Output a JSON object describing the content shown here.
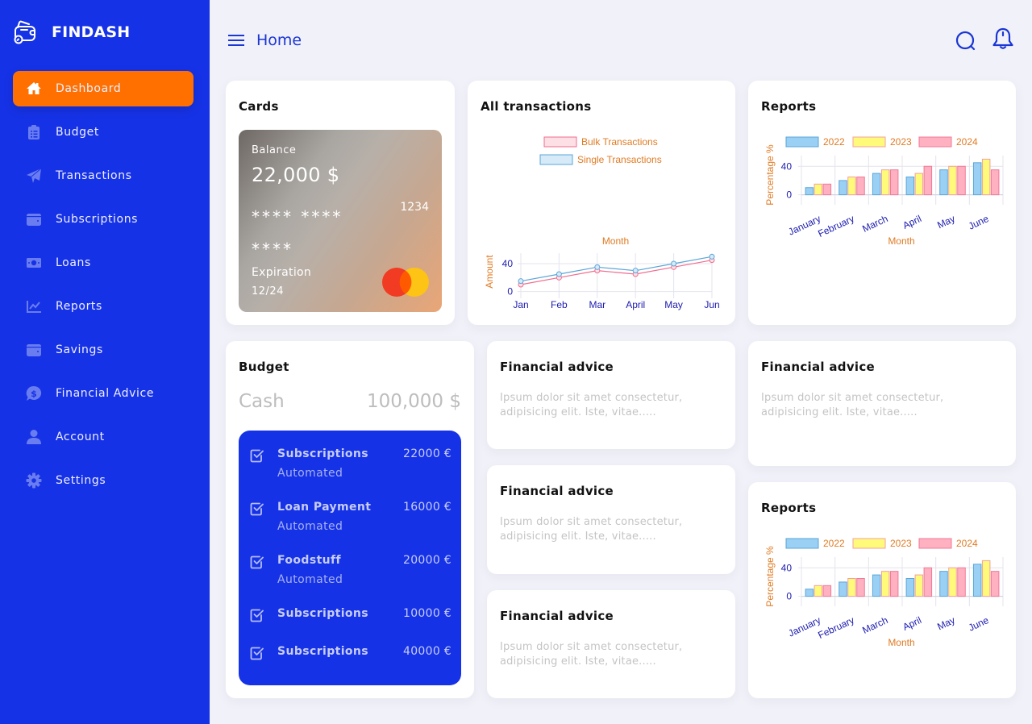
{
  "app": {
    "name": "FINDASH"
  },
  "sidebar": {
    "items": [
      {
        "label": "Dashboard",
        "icon": "home-icon",
        "active": true
      },
      {
        "label": "Budget",
        "icon": "clipboard-list-icon"
      },
      {
        "label": "Transactions",
        "icon": "paper-plane-icon"
      },
      {
        "label": "Subscriptions",
        "icon": "wallet-icon"
      },
      {
        "label": "Loans",
        "icon": "money-bill-icon"
      },
      {
        "label": "Reports",
        "icon": "chart-line-icon"
      },
      {
        "label": "Savings",
        "icon": "wallet-icon"
      },
      {
        "label": "Financial Advice",
        "icon": "comment-dollar-icon"
      },
      {
        "label": "Account",
        "icon": "user-icon"
      },
      {
        "label": "Settings",
        "icon": "gear-icon"
      }
    ]
  },
  "header": {
    "title": "Home",
    "menu_icon": "hamburger-menu-icon",
    "search_icon": "search-icon",
    "bell_icon": "bell-icon"
  },
  "colors": {
    "sidebar": "#1632e6",
    "accent": "#ff7000",
    "background": "#f1f1f9"
  },
  "cards": {
    "title": "Cards",
    "card": {
      "balance_label": "Balance",
      "balance": "22,000 $",
      "number_masked": "**** **** ****",
      "last_digits": "1234",
      "expiration_label": "Expiration",
      "expiration": "12/24",
      "brand_icon": "mastercard-icon"
    }
  },
  "transactions_card": {
    "title": "All transactions"
  },
  "reports_card": {
    "title": "Reports"
  },
  "reports_card_2": {
    "title": "Reports"
  },
  "budget": {
    "title": "Budget",
    "cash_label": "Cash",
    "cash_value": "100,000 $",
    "items": [
      {
        "name": "Subscriptions",
        "amount": "22000 €",
        "status": "Automated"
      },
      {
        "name": "Loan Payment",
        "amount": "16000 €",
        "status": "Automated"
      },
      {
        "name": "Foodstuff",
        "amount": "20000 €",
        "status": "Automated"
      },
      {
        "name": "Subscriptions",
        "amount": "10000 €",
        "status": ""
      },
      {
        "name": "Subscriptions",
        "amount": "40000 €",
        "status": ""
      }
    ]
  },
  "advice": [
    {
      "title": "Financial advice",
      "text": "Ipsum dolor sit amet consectetur, adipisicing elit. Iste, vitae....."
    },
    {
      "title": "Financial advice",
      "text": "Ipsum dolor sit amet consectetur, adipisicing elit. Iste, vitae....."
    },
    {
      "title": "Financial advice",
      "text": "Ipsum dolor sit amet consectetur, adipisicing elit. Iste, vitae....."
    },
    {
      "title": "Financial advice",
      "text": "Ipsum dolor sit amet consectetur, adipisicing elit. Iste, vitae....."
    }
  ],
  "chart_data": [
    {
      "id": "transactions",
      "type": "line",
      "title": "All transactions",
      "categories": [
        "Jan",
        "Feb",
        "Mar",
        "April",
        "May",
        "Jun"
      ],
      "series": [
        {
          "name": "Bulk Transactions",
          "values": [
            10,
            20,
            30,
            25,
            35,
            45
          ],
          "color": "#f06d8f",
          "fill": "#fde0e6"
        },
        {
          "name": "Single Transactions",
          "values": [
            15,
            25,
            35,
            30,
            40,
            50
          ],
          "color": "#5aa6d8",
          "fill": "#d6eaf8"
        }
      ],
      "xlabel": "Month",
      "ylabel": "Amount",
      "yticks": [
        0,
        40
      ],
      "ylim": [
        -5,
        55
      ],
      "legend": "top",
      "grid": true
    },
    {
      "id": "reports",
      "type": "bar",
      "title": "Reports",
      "categories": [
        "January",
        "February",
        "March",
        "April",
        "May",
        "June"
      ],
      "series": [
        {
          "name": "2022",
          "values": [
            10,
            20,
            30,
            25,
            35,
            45
          ],
          "color": "#5aa6d8",
          "fill": "#9bd0f5"
        },
        {
          "name": "2023",
          "values": [
            15,
            25,
            35,
            30,
            40,
            50
          ],
          "color": "#f3a0a0",
          "fill": "#fffa7a"
        },
        {
          "name": "2024",
          "values": [
            15,
            25,
            35,
            40,
            40,
            35
          ],
          "color": "#f07a95",
          "fill": "#ffb1c1"
        }
      ],
      "xlabel": "Month",
      "ylabel": "Percentage %",
      "yticks": [
        0,
        40
      ],
      "ylim": [
        -5,
        55
      ],
      "legend": "top",
      "grid": true
    }
  ]
}
